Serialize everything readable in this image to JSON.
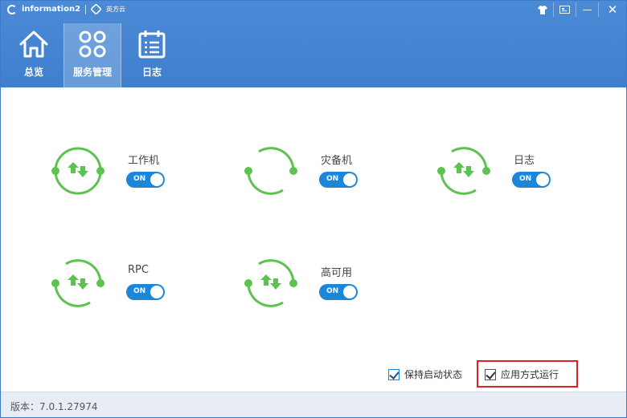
{
  "window": {
    "brand": "information2",
    "brand_secondary": "英方云"
  },
  "window_controls": {
    "skin_icon": "shirt-icon",
    "feedback_icon": "message-icon",
    "minimize_label": "—",
    "close_label": "✕"
  },
  "nav": {
    "items": [
      {
        "label": "总览",
        "icon": "home-icon",
        "active": false
      },
      {
        "label": "服务管理",
        "icon": "grid-icon",
        "active": true
      },
      {
        "label": "日志",
        "icon": "calendar-list-icon",
        "active": false
      }
    ]
  },
  "services": [
    {
      "name": "工作机",
      "toggle": "ON",
      "state": "on",
      "arrows": true
    },
    {
      "name": "灾备机",
      "toggle": "ON",
      "state": "on",
      "arrows": false
    },
    {
      "name": "日志",
      "toggle": "ON",
      "state": "on",
      "arrows": true
    },
    {
      "name": "RPC",
      "toggle": "ON",
      "state": "on",
      "arrows": true
    },
    {
      "name": "高可用",
      "toggle": "ON",
      "state": "on",
      "arrows": true
    }
  ],
  "options": {
    "keep_state_label": "保持启动状态",
    "keep_state_checked": true,
    "app_mode_label": "应用方式运行",
    "app_mode_checked": true
  },
  "footer": {
    "version": "版本：7.0.1.27974"
  },
  "colors": {
    "header": "#4184d2",
    "toggle": "#1b87d9",
    "sync": "#5cc44e",
    "highlight": "#e02020"
  }
}
